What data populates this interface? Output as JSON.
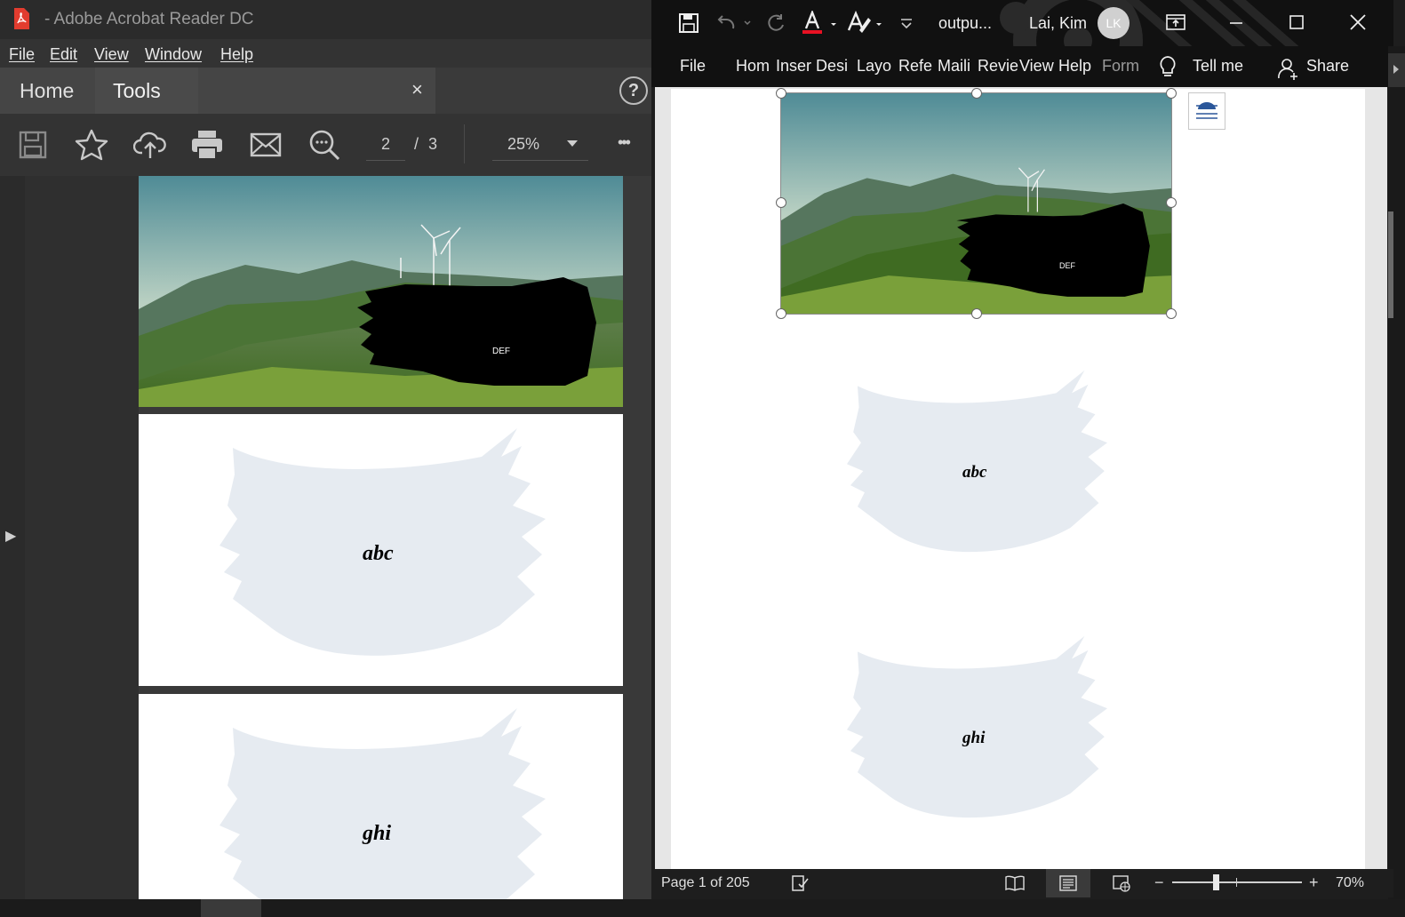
{
  "acrobat": {
    "title": "- Adobe Acrobat Reader DC",
    "menu": [
      "File",
      "Edit",
      "View",
      "Window",
      "Help"
    ],
    "tabs": {
      "home": "Home",
      "tools": "Tools",
      "close": "×",
      "help": "?"
    },
    "toolbar": {
      "page_current": "2",
      "page_sep": "/",
      "page_total": "3",
      "zoom": "25%",
      "more": "•••",
      "icons": [
        "save-icon",
        "bookmark-star-icon",
        "upload-cloud-icon",
        "print-icon",
        "email-icon",
        "zoom-out-icon"
      ]
    },
    "pages": {
      "photo_label": "DEF",
      "brush1_text": "abc",
      "brush2_text": "ghi"
    },
    "sidebar_toggle": "▶"
  },
  "word": {
    "title": {
      "doc_name": "outpu...",
      "user_name": "Lai, Kim",
      "avatar_initials": "LK"
    },
    "ribbon_tabs": [
      "File",
      "Hom",
      "Inser",
      "Desi",
      "Layo",
      "Refe",
      "Maili",
      "Revie",
      "View",
      "Help",
      "Form"
    ],
    "tell_me": "Tell me",
    "share": "Share",
    "document": {
      "photo_label": "DEF",
      "brush1_text": "abc",
      "brush2_text": "ghi"
    },
    "status": {
      "page_info": "Page 1 of 205",
      "zoom": "70%",
      "zoom_minus": "−",
      "zoom_plus": "+"
    }
  },
  "colors": {
    "acrobat_bg": "#2b2b2b",
    "word_bg": "#111111",
    "brush": "#e6ebf1",
    "font_color_red": "#e81123"
  }
}
